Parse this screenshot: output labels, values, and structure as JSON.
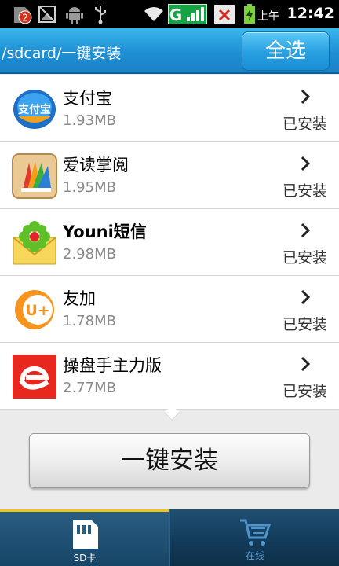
{
  "status_bar": {
    "notification_count": "2",
    "network_badge": "G",
    "ampm": "上午",
    "time": "12:42",
    "icons": [
      "notification-badge-icon",
      "image-icon",
      "android-icon",
      "usb-icon",
      "wifi-icon",
      "signal-icon",
      "no-sim-icon",
      "battery-charging-icon"
    ]
  },
  "header": {
    "path": "/sdcard/一键安装",
    "select_all_label": "全选"
  },
  "apps": [
    {
      "name": "支付宝",
      "size": "1.93MB",
      "status": "已安装",
      "icon": "alipay-icon",
      "icon_text": "支付宝"
    },
    {
      "name": "爱读掌阅",
      "size": "1.95MB",
      "status": "已安装",
      "icon": "ireader-book-icon"
    },
    {
      "name": "Youni短信",
      "size": "2.98MB",
      "status": "已安装",
      "icon": "youni-envelope-flower-icon"
    },
    {
      "name": "友加",
      "size": "1.78MB",
      "status": "已安装",
      "icon": "youjia-icon",
      "icon_text": "U+"
    },
    {
      "name": "操盘手主力版",
      "size": "2.77MB",
      "status": "已安装",
      "icon": "caopanshou-icon"
    }
  ],
  "install_button_label": "一键安装",
  "tabs": [
    {
      "label": "SD卡",
      "icon": "sd-card-icon",
      "active": true
    },
    {
      "label": "在线",
      "icon": "shopping-cart-icon",
      "active": false
    }
  ],
  "colors": {
    "header_blue": "#1e8fd3",
    "tab_active_indicator": "#f2c21b",
    "tab_bar": "#123a58"
  }
}
